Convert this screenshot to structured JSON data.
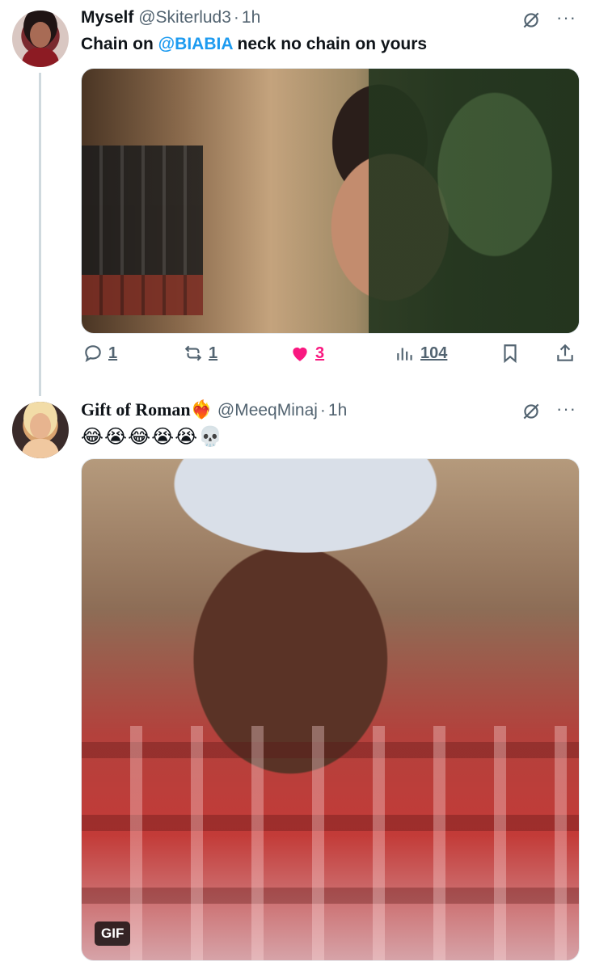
{
  "tweets": [
    {
      "name": "Myself",
      "handle": "@Skiterlud3",
      "dot": "·",
      "time": "1h",
      "text_before": "Chain on ",
      "mention": "@BIABIA",
      "text_after": " neck no chain on yours",
      "stats": {
        "replies": "1",
        "retweets": "1",
        "likes": "3",
        "views": "104"
      }
    },
    {
      "name": "Gift of Roman❤️‍🔥",
      "handle": "@MeeqMinaj",
      "dot": "·",
      "time": "1h",
      "emojis": "😂😭😂😭😭💀",
      "media_badge": "GIF"
    }
  ],
  "more_glyph": "···",
  "colors": {
    "accent": "#1d9bf0",
    "like": "#f91880",
    "secondary_text": "#536471"
  },
  "icons": [
    "grok-icon",
    "more-icon",
    "reply-icon",
    "retweet-icon",
    "heart-icon",
    "views-icon",
    "bookmark-icon",
    "share-icon"
  ]
}
